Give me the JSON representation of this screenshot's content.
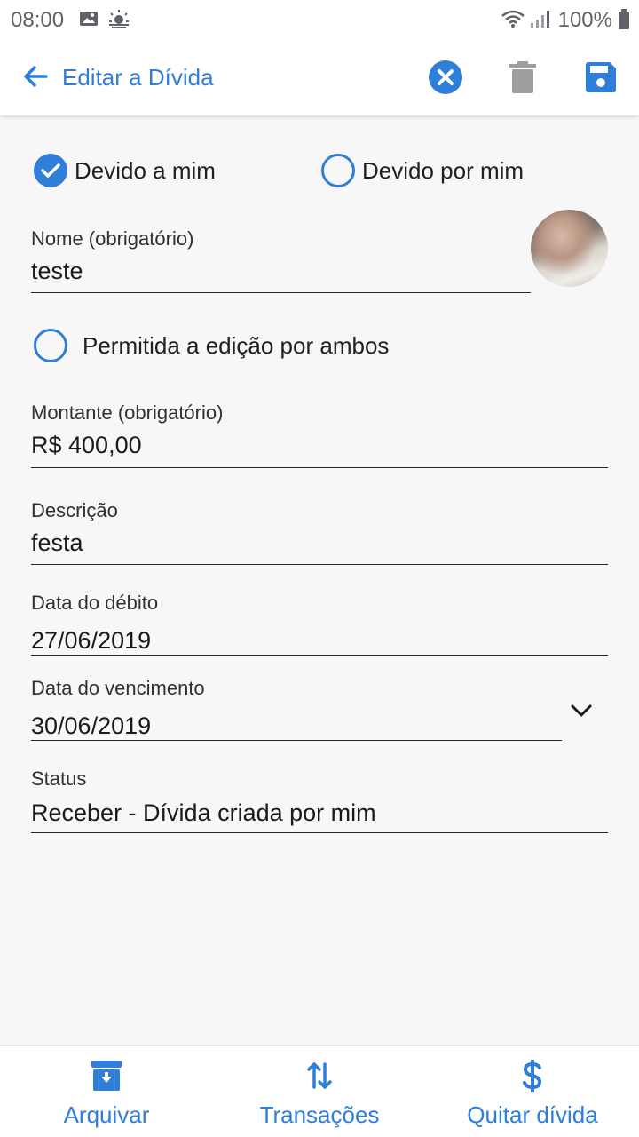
{
  "status_bar": {
    "time": "08:00",
    "battery": "100%"
  },
  "app_bar": {
    "title": "Editar a Dívida"
  },
  "direction": {
    "owed_to_me": "Devido a mim",
    "owed_by_me": "Devido por mim"
  },
  "name": {
    "label": "Nome (obrigatório)",
    "value": "teste"
  },
  "shared_edit": {
    "label": "Permitida a edição por ambos"
  },
  "amount": {
    "label": "Montante (obrigatório)",
    "value": "R$ 400,00"
  },
  "description": {
    "label": "Descrição",
    "value": "festa"
  },
  "debit_date": {
    "label": "Data do débito",
    "value": "27/06/2019"
  },
  "due_date": {
    "label": "Data do vencimento",
    "value": "30/06/2019"
  },
  "status": {
    "label": "Status",
    "value": "Receber - Dívida criada por mim"
  },
  "bottom_nav": {
    "archive": "Arquivar",
    "transactions": "Transações",
    "settle": "Quitar dívida"
  },
  "colors": {
    "accent": "#2f7ed8",
    "icon_gray": "#9e9e9e"
  }
}
